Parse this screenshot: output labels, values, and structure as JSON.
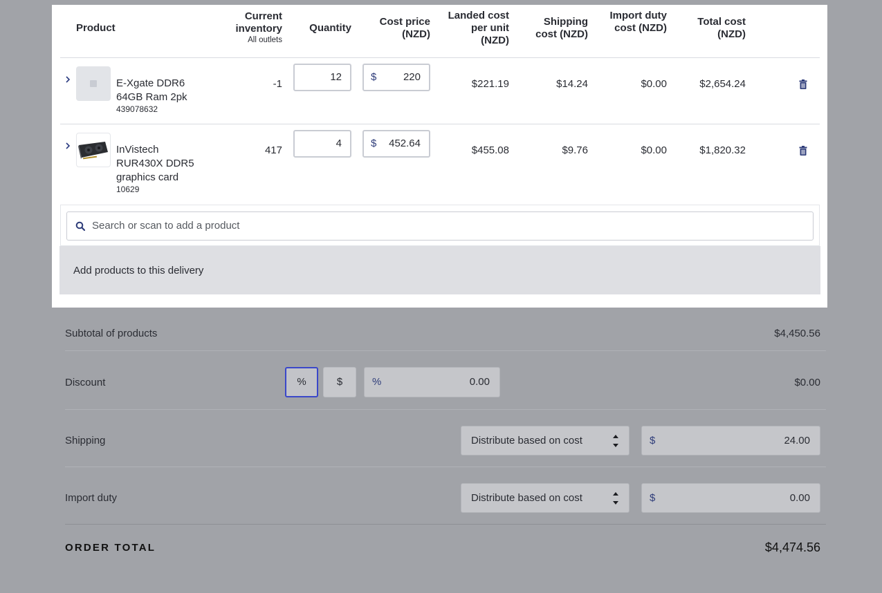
{
  "table": {
    "headers": {
      "product": "Product",
      "current_inventory": "Current inventory",
      "current_inventory_sub": "All outlets",
      "quantity": "Quantity",
      "cost_price": "Cost price (NZD)",
      "landed_cost": "Landed cost per unit (NZD)",
      "shipping_cost": "Shipping cost (NZD)",
      "import_duty_cost": "Import duty cost (NZD)",
      "total_cost": "Total cost (NZD)"
    },
    "rows": [
      {
        "name": "E-Xgate DDR6 64GB Ram 2pk",
        "sku": "439078632",
        "inventory": "-1",
        "quantity": "12",
        "currency_symbol": "$",
        "cost_price": "220",
        "landed_cost": "$221.19",
        "shipping_cost": "$14.24",
        "import_duty": "$0.00",
        "total_cost": "$2,654.24",
        "thumbnail": "placeholder-image-icon"
      },
      {
        "name": "InVistech RUR430X DDR5 graphics card",
        "sku": "10629",
        "inventory": "417",
        "quantity": "4",
        "currency_symbol": "$",
        "cost_price": "452.64",
        "landed_cost": "$455.08",
        "shipping_cost": "$9.76",
        "import_duty": "$0.00",
        "total_cost": "$1,820.32",
        "thumbnail": "graphics-card-image"
      }
    ]
  },
  "search": {
    "placeholder": "Search or scan to add a product"
  },
  "add_products": {
    "label": "Add products to this delivery"
  },
  "summary": {
    "subtotal_label": "Subtotal of products",
    "subtotal_value": "$4,450.56",
    "discount_label": "Discount",
    "discount_toggle_percent": "%",
    "discount_toggle_dollar": "$",
    "discount_input_prefix": "%",
    "discount_input_value": "0.00",
    "discount_value": "$0.00",
    "shipping_label": "Shipping",
    "shipping_method": "Distribute based on cost",
    "shipping_prefix": "$",
    "shipping_value": "24.00",
    "import_duty_label": "Import duty",
    "import_duty_method": "Distribute based on cost",
    "import_duty_prefix": "$",
    "import_duty_value": "0.00",
    "order_total_label": "ORDER TOTAL",
    "order_total_value": "$4,474.56"
  },
  "colors": {
    "accent": "#3a47c9",
    "icon": "#2f3d7a",
    "overlay": "#a1a3a8"
  }
}
